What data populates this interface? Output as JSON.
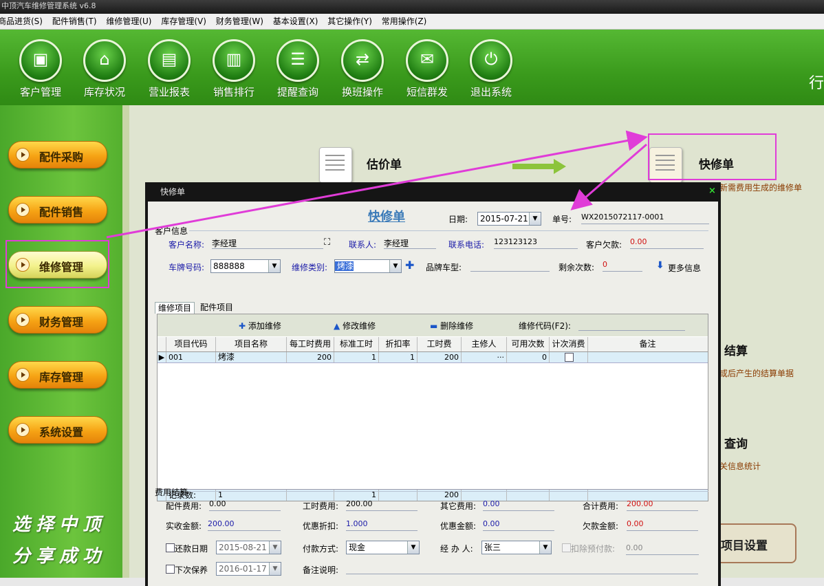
{
  "window": {
    "title": "中顶汽车维修管理系统 v6.8"
  },
  "menu": [
    "商品进货(S)",
    "配件销售(T)",
    "维修管理(U)",
    "库存管理(V)",
    "财务管理(W)",
    "基本设置(X)",
    "其它操作(Y)",
    "常用操作(Z)"
  ],
  "toolbar": {
    "items": [
      {
        "label": "客户管理",
        "icon": "customer-icon"
      },
      {
        "label": "库存状况",
        "icon": "home-icon"
      },
      {
        "label": "营业报表",
        "icon": "report-icon"
      },
      {
        "label": "销售排行",
        "icon": "bar-chart-icon"
      },
      {
        "label": "提醒查询",
        "icon": "message-icon"
      },
      {
        "label": "换班操作",
        "icon": "swap-icon"
      },
      {
        "label": "短信群发",
        "icon": "sms-icon"
      },
      {
        "label": "退出系统",
        "icon": "power-icon"
      }
    ],
    "right_text": "行"
  },
  "sidebar": {
    "items": [
      "配件采购",
      "配件销售",
      "维修管理",
      "财务管理",
      "库存管理",
      "系统设置"
    ],
    "active": "维修管理",
    "slogan1": "选择中顶",
    "slogan2": "分享成功"
  },
  "content": {
    "estimate_title": "估价单",
    "quick_title": "快修单",
    "quick_sub": "新需费用生成的维修单",
    "settle_title": "结算",
    "settle_sub": "或后产生的结算单据",
    "query_title": "查询",
    "query_sub": "关信息统计",
    "project_settings": "项目设置"
  },
  "dialog": {
    "title": "快修单",
    "heading": "快修单",
    "date_label": "日期:",
    "date_value": "2015-07-21",
    "order_label": "单号:",
    "order_value": "WX2015072117-0001",
    "customer_section": "客户信息",
    "customer_name_label": "客户名称:",
    "customer_name": "李经理",
    "contact_label": "联系人:",
    "contact": "李经理",
    "phone_label": "联系电话:",
    "phone": "123123123",
    "debt_label": "客户欠款:",
    "debt": "0.00",
    "plate_label": "车牌号码:",
    "plate": "888888",
    "repair_type_label": "维修类别:",
    "repair_type": "烤漆",
    "brand_label": "品牌车型:",
    "brand": "",
    "remaining_label": "剩余次数:",
    "remaining": "0",
    "more_info": "更多信息",
    "tabs": [
      "维修项目",
      "配件项目"
    ],
    "grid_tools": {
      "add": "添加维修",
      "edit": "修改维修",
      "delete": "删除维修",
      "code_label": "维修代码(F2):"
    },
    "columns": [
      "项目代码",
      "项目名称",
      "每工时费用",
      "标准工时",
      "折扣率",
      "工时费",
      "主修人",
      "可用次数",
      "计次消费",
      "备注"
    ],
    "rows": [
      {
        "code": "001",
        "name": "烤漆",
        "rate": "200",
        "hours": "1",
        "discount": "1",
        "fee": "200",
        "worker": "···",
        "available": "0",
        "count_use": false,
        "remark": ""
      }
    ],
    "footer": {
      "label": "记录数:",
      "count": "1",
      "hours": "1",
      "fee": "200"
    },
    "fee_section": "费用结算",
    "parts_fee_label": "配件费用:",
    "parts_fee": "0.00",
    "labor_fee_label": "工时费用:",
    "labor_fee": "200.00",
    "other_fee_label": "其它费用:",
    "other_fee": "0.00",
    "total_label": "合计费用:",
    "total": "200.00",
    "received_label": "实收金额:",
    "received": "200.00",
    "discount_label": "优惠折扣:",
    "discount": "1.000",
    "discount_amount_label": "优惠金额:",
    "discount_amount": "0.00",
    "owed_label": "欠款金额:",
    "owed": "0.00",
    "repay_date_label": "还款日期",
    "repay_date": "2015-08-21",
    "pay_method_label": "付款方式:",
    "pay_method": "现金",
    "handler_label": "经 办 人:",
    "handler": "张三",
    "prepay_label": "扣除预付款:",
    "prepay": "0.00",
    "next_maint_label": "下次保养",
    "next_maint": "2016-01-17",
    "remark_label": "备注说明:"
  },
  "colors": {
    "highlight": "#e03cd8",
    "toolbar_green": "#3a9a1c",
    "button_orange": "#f6a314"
  }
}
